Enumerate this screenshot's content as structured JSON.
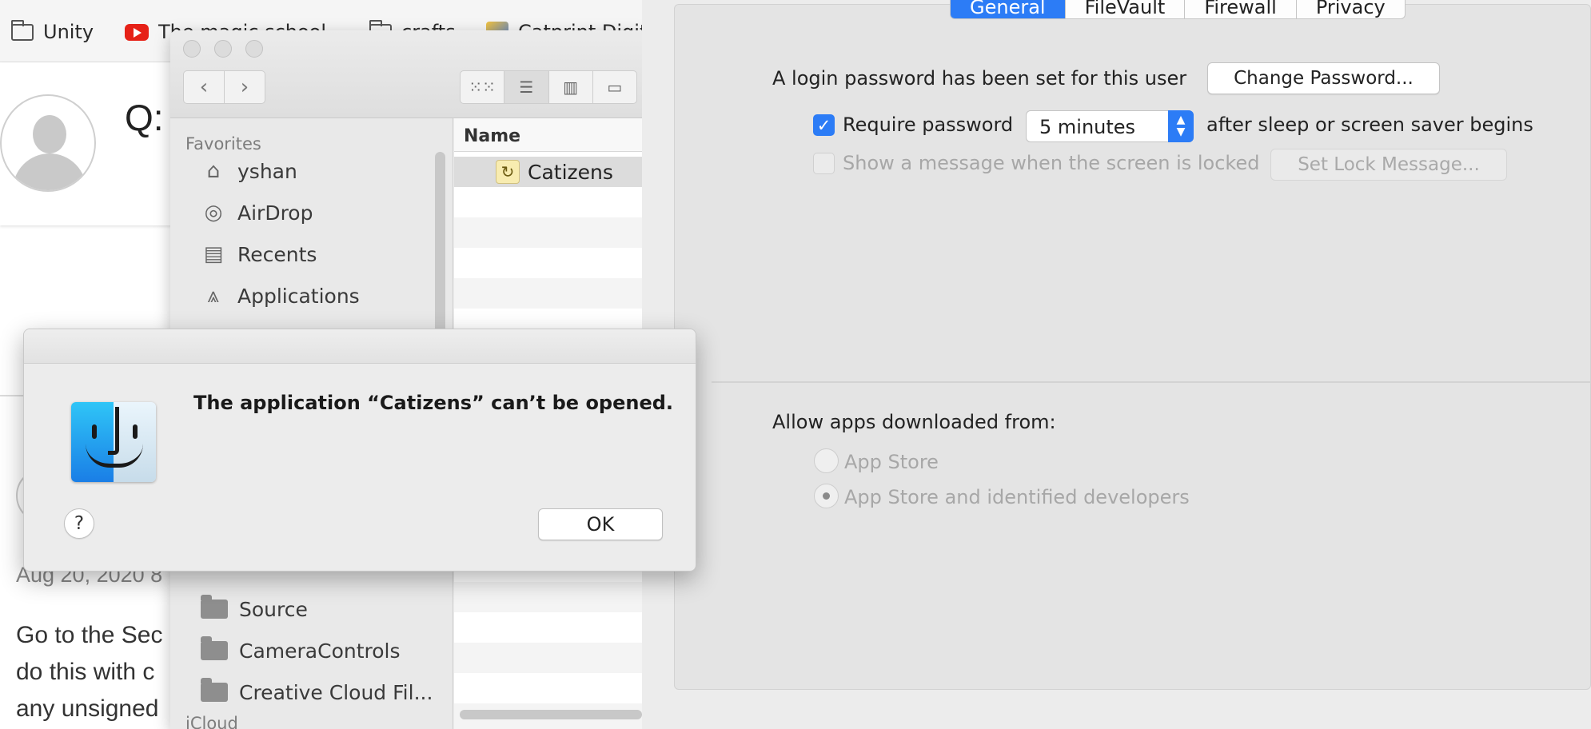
{
  "browser": {
    "bookmarks": [
      {
        "label": "Unity",
        "icon": "folder-icon"
      },
      {
        "label": "The magic school",
        "icon": "youtube-icon"
      },
      {
        "label": "crafts",
        "icon": "folder-icon"
      },
      {
        "label": "Catprint Digit",
        "icon": "catprint-icon"
      }
    ],
    "question_prefix": "Q:",
    "answer_date": "Aug 20, 2020 8",
    "answer_lines": [
      "Go to the Sec",
      "do this with c",
      "any unsigned"
    ]
  },
  "finder": {
    "sidebar": {
      "favorites_header": "Favorites",
      "favorites": [
        {
          "label": "yshan",
          "icon": "home-icon"
        },
        {
          "label": "AirDrop",
          "icon": "airdrop-icon"
        },
        {
          "label": "Recents",
          "icon": "recents-icon"
        },
        {
          "label": "Applications",
          "icon": "applications-icon"
        }
      ],
      "folders": [
        {
          "label": "Source",
          "icon": "folder-icon"
        },
        {
          "label": "CameraControls",
          "icon": "folder-icon"
        },
        {
          "label": "Creative Cloud Fil...",
          "icon": "folder-icon"
        }
      ],
      "icloud_header": "iCloud"
    },
    "list": {
      "column_name": "Name",
      "selected_item": "Catizens"
    },
    "nav": {
      "back": "‹",
      "forward": "›"
    }
  },
  "alert": {
    "message": "The application “Catizens” can’t be opened.",
    "ok_label": "OK",
    "help_label": "?"
  },
  "prefs": {
    "tabs": [
      {
        "label": "General",
        "active": true
      },
      {
        "label": "FileVault",
        "active": false
      },
      {
        "label": "Firewall",
        "active": false
      },
      {
        "label": "Privacy",
        "active": false
      }
    ],
    "login_text": "A login password has been set for this user",
    "change_password_label": "Change Password...",
    "require_password_label": "Require password",
    "require_password_checked": true,
    "require_password_delay": "5 minutes",
    "after_sleep_text": "after sleep or screen saver begins",
    "show_message_label": "Show a message when the screen is locked",
    "set_lock_message_label": "Set Lock Message...",
    "allow_apps_label": "Allow apps downloaded from:",
    "options": [
      {
        "label": "App Store",
        "selected": false
      },
      {
        "label": "App Store and identified developers",
        "selected": true
      }
    ],
    "accent_color": "#2c7cf6"
  }
}
